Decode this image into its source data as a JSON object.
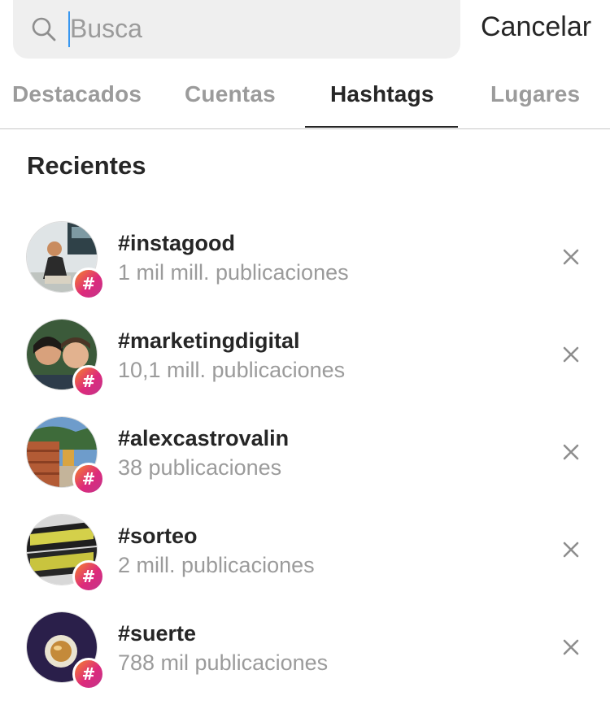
{
  "search": {
    "placeholder": "Busca",
    "value": "",
    "icon": "search-icon",
    "cancel_label": "Cancelar"
  },
  "tabs": [
    {
      "label": "Destacados",
      "active": false
    },
    {
      "label": "Cuentas",
      "active": false
    },
    {
      "label": "Hashtags",
      "active": true
    },
    {
      "label": "Lugares",
      "active": false
    }
  ],
  "section_title": "Recientes",
  "recent": [
    {
      "tag": "#instagood",
      "count": "1 mil mill. publicaciones"
    },
    {
      "tag": "#marketingdigital",
      "count": "10,1 mill. publicaciones"
    },
    {
      "tag": "#alexcastrovalin",
      "count": "38 publicaciones"
    },
    {
      "tag": "#sorteo",
      "count": "2 mill. publicaciones"
    },
    {
      "tag": "#suerte",
      "count": "788 mil publicaciones"
    }
  ],
  "badge_symbol": "#",
  "colors": {
    "accent_caret": "#3897f0",
    "badge_start": "#f58529",
    "badge_end": "#c1358c",
    "muted_text": "#9b9b9b"
  }
}
